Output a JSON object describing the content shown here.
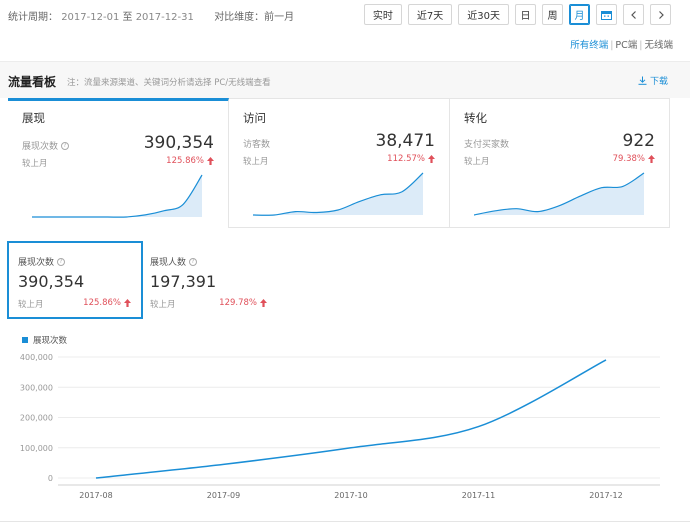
{
  "header": {
    "period_label": "统计周期：",
    "period_start": "2017-12-01",
    "period_to": "至",
    "period_end": "2017-12-31",
    "compare_label": "对比维度：前一月",
    "range_buttons": [
      "实时",
      "近7天",
      "近30天",
      "日",
      "周",
      "月"
    ],
    "active_range": "月",
    "calendar_icon": "calendar-icon",
    "prev_icon": "chevron-left-icon",
    "next_icon": "chevron-right-icon",
    "terminal_options": [
      "所有终端",
      "PC端",
      "无线端"
    ],
    "terminal_active": "所有终端",
    "accent_color": "#1a8ed6"
  },
  "panel": {
    "title": "流量看板",
    "note": "注：流量来源渠道、关键词分析请选择 PC/无线端查看",
    "download_label": "下载",
    "download_icon": "download-icon"
  },
  "cards": [
    {
      "title": "展现",
      "metric": "展现次数",
      "value": "390,354",
      "compare": "较上月",
      "pct": "125.86%",
      "trend": "up",
      "spark": [
        0,
        0,
        0,
        0,
        0,
        0,
        0.05,
        0.15,
        0.3,
        1.0
      ]
    },
    {
      "title": "访问",
      "metric": "访客数",
      "value": "38,471",
      "compare": "较上月",
      "pct": "112.57%",
      "trend": "up",
      "spark": [
        0,
        0,
        0.08,
        0.06,
        0.12,
        0.32,
        0.48,
        0.55,
        1.0
      ]
    },
    {
      "title": "转化",
      "metric": "支付买家数",
      "value": "922",
      "compare": "较上月",
      "pct": "79.38%",
      "trend": "up",
      "spark": [
        0,
        0.1,
        0.15,
        0.08,
        0.22,
        0.45,
        0.65,
        0.68,
        1.0
      ]
    }
  ],
  "sub_metrics": [
    {
      "label": "展现次数",
      "value": "390,354",
      "compare": "较上月",
      "pct": "125.86%",
      "selected": true
    },
    {
      "label": "展现人数",
      "value": "197,391",
      "compare": "较上月",
      "pct": "129.78%",
      "selected": false
    }
  ],
  "up_color": "#e0505a",
  "chart_data": {
    "type": "line",
    "series": [
      {
        "name": "展现次数",
        "values": [
          0,
          45000,
          100000,
          170000,
          390354
        ]
      }
    ],
    "categories": [
      "2017-08",
      "2017-09",
      "2017-10",
      "2017-11",
      "2017-12"
    ],
    "y_ticks": [
      "400,000",
      "300,000",
      "200,000",
      "100,000",
      "0"
    ],
    "ylim": [
      0,
      400000
    ],
    "grid": true,
    "legend": "top-left",
    "color": "#1a8ed6"
  }
}
